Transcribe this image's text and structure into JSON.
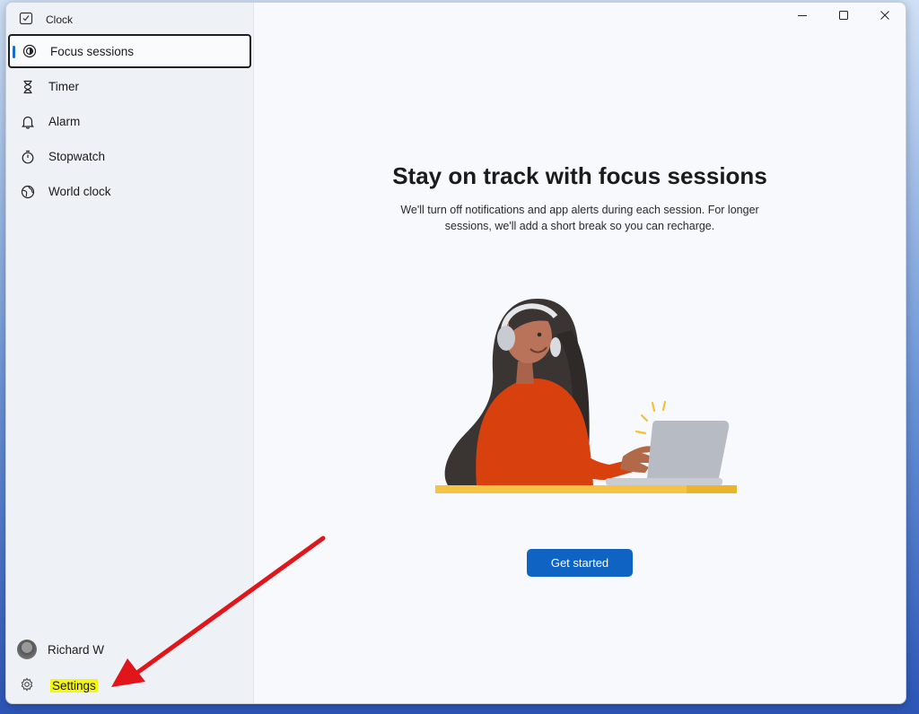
{
  "app": {
    "title": "Clock"
  },
  "window_controls": {
    "minimize": "minimize-icon",
    "maximize": "maximize-icon",
    "close": "close-icon"
  },
  "sidebar": {
    "items": [
      {
        "label": "Focus sessions",
        "icon": "focus-icon",
        "active": true
      },
      {
        "label": "Timer",
        "icon": "hourglass-icon"
      },
      {
        "label": "Alarm",
        "icon": "bell-icon"
      },
      {
        "label": "Stopwatch",
        "icon": "stopwatch-icon"
      },
      {
        "label": "World clock",
        "icon": "globe-icon"
      }
    ],
    "user": {
      "name": "Richard W"
    },
    "settings": {
      "label": "Settings"
    }
  },
  "main": {
    "headline": "Stay on track with focus sessions",
    "description_line1": "We'll turn off notifications and app alerts during each session. For longer",
    "description_line2": "sessions, we'll add a short break so you can recharge.",
    "cta_label": "Get started"
  },
  "colors": {
    "accent": "#0f63c2",
    "highlight": "#f4f614",
    "annotation_arrow": "#e0161b"
  }
}
